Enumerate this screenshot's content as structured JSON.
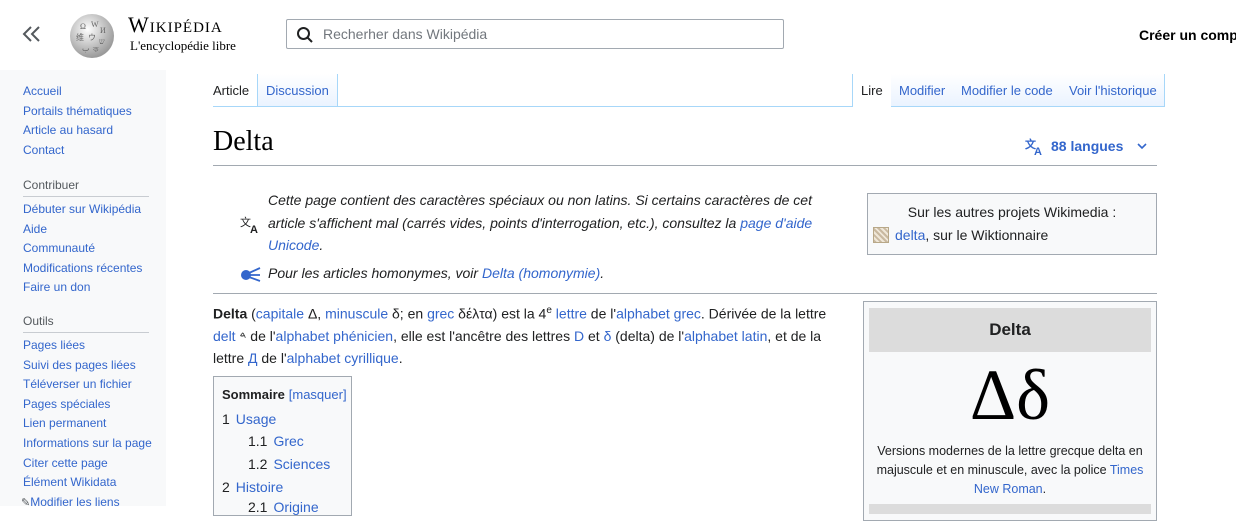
{
  "header": {
    "wordmark_title": "Wikipédia",
    "wordmark_tagline": "L'encyclopédie libre",
    "search_placeholder": "Recherher dans Wikipédia",
    "create_account": "Créer un comp"
  },
  "sidebar": {
    "nav": [
      "Accueil",
      "Portails thématiques",
      "Article au hasard",
      "Contact"
    ],
    "contribute_heading": "Contribuer",
    "contribute": [
      "Débuter sur Wikipédia",
      "Aide",
      "Communauté",
      "Modifications récentes",
      "Faire un don"
    ],
    "tools_heading": "Outils",
    "tools": [
      "Pages liées",
      "Suivi des pages liées",
      "Téléverser un fichier",
      "Pages spéciales",
      "Lien permanent",
      "Informations sur la page",
      "Citer cette page",
      "Élément Wikidata",
      "Modifier les liens"
    ]
  },
  "tabs": {
    "article": "Article",
    "discussion": "Discussion",
    "read": "Lire",
    "edit": "Modifier",
    "edit_code": "Modifier le code",
    "history": "Voir l'historique"
  },
  "page": {
    "title": "Delta",
    "languages": "88 langues"
  },
  "notices": {
    "special_chars_1": "Cette page contient des caractères spéciaux ou non latins. Si certains caractères de cet",
    "special_chars_2": "article s'affichent mal (carrés vides, points d'interrogation, etc.), consultez la ",
    "special_chars_link_a": "page d'aide",
    "special_chars_link_b": "Unicode",
    "special_chars_end": ".",
    "homonym_text": "Pour les articles homonymes, voir ",
    "homonym_link": "Delta (homonymie)",
    "homonym_end": ".",
    "other_projects": "Sur les autres projets Wikimedia :",
    "wiktionary_link": "delta",
    "wiktionary_text": ", sur le Wiktionnaire"
  },
  "intro": {
    "bold": "Delta",
    "p1": " (",
    "capitale": "capitale",
    "p2": " Δ, ",
    "minuscule": "minuscule",
    "p3": " δ; en ",
    "grec": "grec",
    "p4": " δέλτα) est la 4",
    "sup": "e",
    "p5": " ",
    "lettre": "lettre",
    "p6": " de l'",
    "alphabet_grec": "alphabet grec",
    "p7": ". Dérivée de la lettre",
    "delt": "delt",
    "p8": " 𐤃 de l'",
    "alphabet_phenicien": "alphabet phénicien",
    "p9": ", elle est l'ancêtre des lettres ",
    "D": "D",
    "p10": " et ",
    "d_delta": "δ",
    "p11": " (delta) de l'",
    "alphabet_latin": "alphabet latin",
    "p12": ", et de la",
    "p13": "lettre ",
    "de_cyr": "Д",
    "p14": " de l'",
    "alphabet_cyrillique": "alphabet cyrillique",
    "p15": "."
  },
  "toc": {
    "heading": "Sommaire",
    "toggle": "[masquer]",
    "items": [
      {
        "num": "1",
        "label": "Usage"
      },
      {
        "num": "1.1",
        "label": "Grec"
      },
      {
        "num": "1.2",
        "label": "Sciences"
      },
      {
        "num": "2",
        "label": "Histoire"
      },
      {
        "num": "2.1",
        "label": "Origine"
      }
    ]
  },
  "infobox": {
    "title": "Delta",
    "glyphs": "Δδ",
    "caption_text": "Versions modernes de la lettre grecque delta en majuscule et en minuscule, avec la police ",
    "caption_link": "Times New Roman",
    "caption_end": "."
  }
}
